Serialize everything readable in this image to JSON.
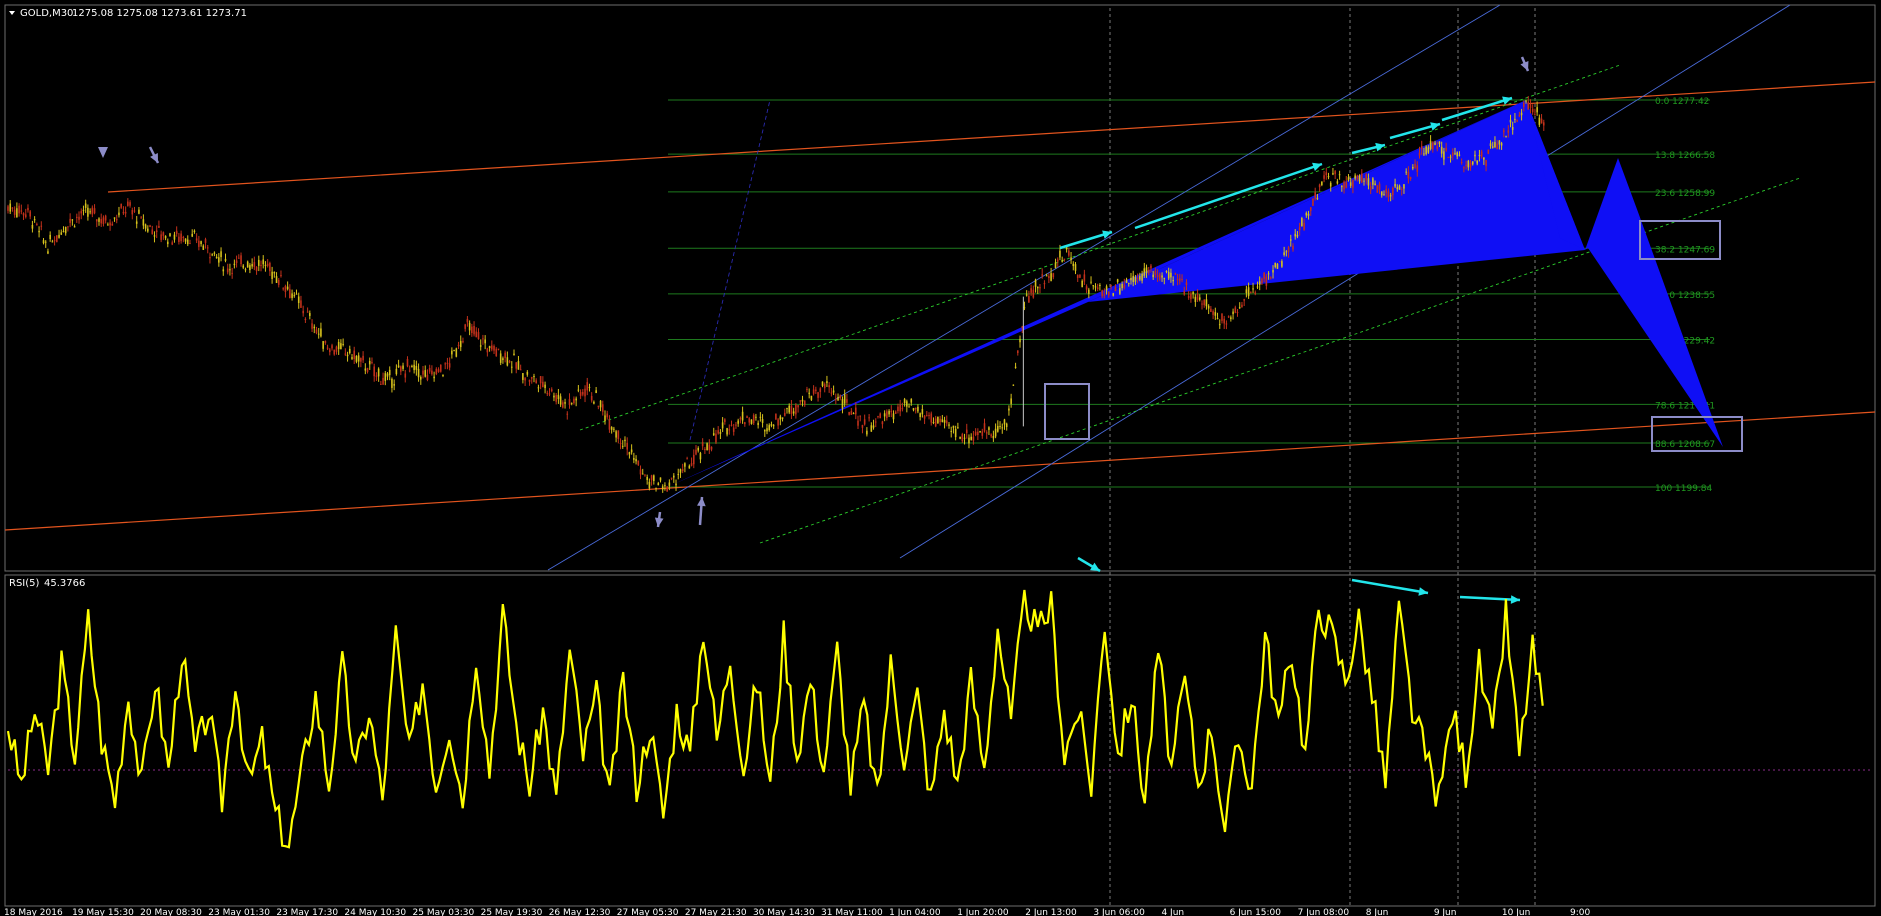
{
  "header": {
    "symbol": "GOLD,M30",
    "ohlc": "1275.08 1275.08 1273.61 1273.71"
  },
  "indicator": {
    "name": "RSI(5)",
    "value": "45.3766"
  },
  "colors": {
    "background": "#000000",
    "candle_up": "#d7c21c",
    "candle_down": "#c3311b",
    "pattern_fill": "#0f0ff5",
    "rsi_line": "#ffff00",
    "trend_line": "#e2541e",
    "channel_line": "#4a6bdb",
    "fib_line": "#1e7a1e",
    "arrow": "#22e5ea",
    "box": "#8c8cc8"
  },
  "chart_data": [
    {
      "type": "candlestick",
      "title": "GOLD,M30",
      "y_axis": "price",
      "fibonacci_levels": [
        {
          "label": "0.0 1277.42",
          "value": 1277.42
        },
        {
          "label": "13.8 1266.58",
          "value": 1266.58
        },
        {
          "label": "23.6 1258.99",
          "value": 1258.99
        },
        {
          "label": "38.2 1247.69",
          "value": 1247.69
        },
        {
          "label": "50.0 1238.55",
          "value": 1238.55
        },
        {
          "label": "61.8 1229.42",
          "value": 1229.42
        },
        {
          "label": "78.6 1216.41",
          "value": 1216.41
        },
        {
          "label": "88.6 1208.67",
          "value": 1208.67
        },
        {
          "label": "100 1199.84",
          "value": 1199.84
        }
      ],
      "x_ticks": [
        "18 May 2016",
        "19 May 15:30",
        "20 May 08:30",
        "23 May 01:30",
        "23 May 17:30",
        "24 May 10:30",
        "25 May 03:30",
        "25 May 19:30",
        "26 May 12:30",
        "27 May 05:30",
        "27 May 21:30",
        "30 May 14:30",
        "31 May 11:00",
        "1 Jun 04:00",
        "1 Jun 20:00",
        "2 Jun 13:00",
        "3 Jun 06:00",
        "4 Jun",
        "6 Jun 15:00",
        "7 Jun 08:00",
        "8 Jun",
        "9 Jun",
        "10 Jun",
        "9:00"
      ],
      "close_path": [
        [
          0,
          1256
        ],
        [
          3,
          1255
        ],
        [
          6,
          1248
        ],
        [
          9,
          1253
        ],
        [
          12,
          1255
        ],
        [
          15,
          1253
        ],
        [
          18,
          1256
        ],
        [
          21,
          1252
        ],
        [
          24,
          1250
        ],
        [
          27,
          1250
        ],
        [
          30,
          1248
        ],
        [
          33,
          1244
        ],
        [
          36,
          1245
        ],
        [
          39,
          1244
        ],
        [
          42,
          1240
        ],
        [
          45,
          1234
        ],
        [
          48,
          1228
        ],
        [
          51,
          1227
        ],
        [
          54,
          1224
        ],
        [
          57,
          1221
        ],
        [
          60,
          1224
        ],
        [
          63,
          1222
        ],
        [
          66,
          1224
        ],
        [
          69,
          1232
        ],
        [
          72,
          1228
        ],
        [
          75,
          1226
        ],
        [
          78,
          1222
        ],
        [
          81,
          1220
        ],
        [
          84,
          1216
        ],
        [
          87,
          1220
        ],
        [
          90,
          1214
        ],
        [
          93,
          1208
        ],
        [
          96,
          1201
        ],
        [
          99,
          1199.8
        ],
        [
          102,
          1204
        ],
        [
          105,
          1208
        ],
        [
          108,
          1212
        ],
        [
          111,
          1214
        ],
        [
          114,
          1212
        ],
        [
          117,
          1215
        ],
        [
          120,
          1218
        ],
        [
          123,
          1220
        ],
        [
          126,
          1216
        ],
        [
          129,
          1212
        ],
        [
          132,
          1214
        ],
        [
          135,
          1216
        ],
        [
          138,
          1214
        ],
        [
          141,
          1212
        ],
        [
          144,
          1210
        ],
        [
          147,
          1211
        ],
        [
          150,
          1212
        ],
        [
          153,
          1238
        ],
        [
          156,
          1242
        ],
        [
          159,
          1247
        ],
        [
          162,
          1240
        ],
        [
          165,
          1239
        ],
        [
          168,
          1241
        ],
        [
          171,
          1243
        ],
        [
          174,
          1242
        ],
        [
          177,
          1240
        ],
        [
          180,
          1236
        ],
        [
          183,
          1233
        ],
        [
          186,
          1238
        ],
        [
          189,
          1242
        ],
        [
          192,
          1246
        ],
        [
          195,
          1254
        ],
        [
          198,
          1262
        ],
        [
          201,
          1261
        ],
        [
          204,
          1262
        ],
        [
          207,
          1258
        ],
        [
          210,
          1261
        ],
        [
          213,
          1268
        ],
        [
          216,
          1267
        ],
        [
          219,
          1265
        ],
        [
          222,
          1266
        ],
        [
          225,
          1270
        ],
        [
          228,
          1277.4
        ],
        [
          231,
          1272
        ]
      ],
      "projection_levels": [
        1247.69,
        1208.67
      ]
    },
    {
      "type": "line",
      "title": "RSI(5) 45.3766",
      "name": "RSI(5)",
      "ylim": [
        0,
        100
      ],
      "reference_level": 50,
      "points": [
        [
          0,
          55
        ],
        [
          2,
          35
        ],
        [
          4,
          60
        ],
        [
          6,
          40
        ],
        [
          8,
          75
        ],
        [
          10,
          45
        ],
        [
          12,
          90
        ],
        [
          14,
          50
        ],
        [
          16,
          30
        ],
        [
          18,
          65
        ],
        [
          20,
          35
        ],
        [
          22,
          70
        ],
        [
          24,
          40
        ],
        [
          26,
          80
        ],
        [
          28,
          45
        ],
        [
          30,
          60
        ],
        [
          32,
          30
        ],
        [
          34,
          70
        ],
        [
          36,
          35
        ],
        [
          38,
          50
        ],
        [
          40,
          25
        ],
        [
          42,
          15
        ],
        [
          44,
          40
        ],
        [
          46,
          65
        ],
        [
          48,
          35
        ],
        [
          50,
          75
        ],
        [
          52,
          40
        ],
        [
          54,
          60
        ],
        [
          56,
          30
        ],
        [
          58,
          85
        ],
        [
          60,
          45
        ],
        [
          62,
          70
        ],
        [
          64,
          35
        ],
        [
          66,
          55
        ],
        [
          68,
          30
        ],
        [
          70,
          80
        ],
        [
          72,
          40
        ],
        [
          74,
          92
        ],
        [
          76,
          55
        ],
        [
          78,
          35
        ],
        [
          80,
          60
        ],
        [
          82,
          30
        ],
        [
          84,
          80
        ],
        [
          86,
          45
        ],
        [
          88,
          65
        ],
        [
          90,
          30
        ],
        [
          92,
          70
        ],
        [
          94,
          35
        ],
        [
          96,
          55
        ],
        [
          98,
          25
        ],
        [
          100,
          60
        ],
        [
          102,
          45
        ],
        [
          104,
          88
        ],
        [
          106,
          50
        ],
        [
          108,
          78
        ],
        [
          110,
          40
        ],
        [
          112,
          70
        ],
        [
          114,
          35
        ],
        [
          116,
          85
        ],
        [
          118,
          45
        ],
        [
          120,
          70
        ],
        [
          122,
          40
        ],
        [
          124,
          80
        ],
        [
          126,
          35
        ],
        [
          128,
          62
        ],
        [
          130,
          30
        ],
        [
          132,
          75
        ],
        [
          134,
          45
        ],
        [
          136,
          65
        ],
        [
          138,
          30
        ],
        [
          140,
          60
        ],
        [
          142,
          35
        ],
        [
          144,
          70
        ],
        [
          146,
          40
        ],
        [
          148,
          88
        ],
        [
          150,
          55
        ],
        [
          152,
          98
        ],
        [
          154,
          85
        ],
        [
          156,
          95
        ],
        [
          158,
          45
        ],
        [
          160,
          60
        ],
        [
          162,
          35
        ],
        [
          164,
          90
        ],
        [
          166,
          45
        ],
        [
          168,
          65
        ],
        [
          170,
          30
        ],
        [
          172,
          80
        ],
        [
          174,
          40
        ],
        [
          176,
          70
        ],
        [
          178,
          35
        ],
        [
          180,
          55
        ],
        [
          182,
          20
        ],
        [
          184,
          50
        ],
        [
          186,
          35
        ],
        [
          188,
          85
        ],
        [
          190,
          55
        ],
        [
          192,
          80
        ],
        [
          194,
          45
        ],
        [
          196,
          95
        ],
        [
          198,
          85
        ],
        [
          200,
          70
        ],
        [
          202,
          90
        ],
        [
          204,
          65
        ],
        [
          206,
          35
        ],
        [
          208,
          93
        ],
        [
          210,
          60
        ],
        [
          212,
          45
        ],
        [
          214,
          30
        ],
        [
          216,
          60
        ],
        [
          218,
          40
        ],
        [
          220,
          75
        ],
        [
          222,
          50
        ],
        [
          224,
          92
        ],
        [
          226,
          45
        ],
        [
          228,
          80
        ],
        [
          230,
          55
        ]
      ]
    }
  ]
}
